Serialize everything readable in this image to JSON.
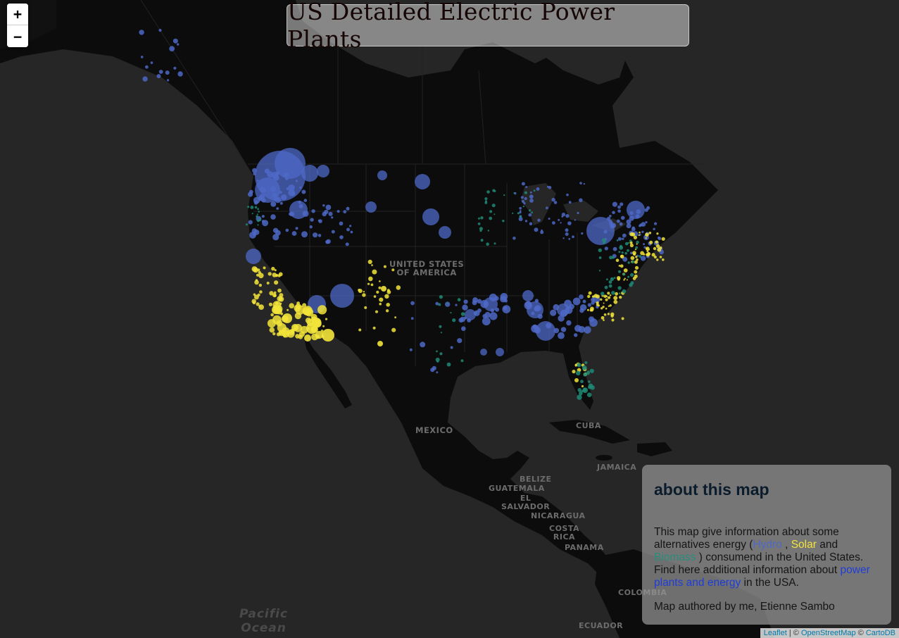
{
  "title": "US Detailed Electric Power Plants",
  "zoom": {
    "in_label": "+",
    "out_label": "−"
  },
  "map_labels": {
    "usa_line1": "UNITED STATES",
    "usa_line2": "OF AMERICA",
    "mexico": "MEXICO",
    "cuba": "CUBA",
    "jamaica": "JAMAICA",
    "belize": "BELIZE",
    "guatemala": "GUATEMALA",
    "el_salvador_line1": "EL",
    "el_salvador_line2": "SALVADOR",
    "nicaragua": "NICARAGUA",
    "costa_rica_line1": "COSTA",
    "costa_rica_line2": "RICA",
    "panama": "PANAMA",
    "colombia": "COLOMBIA",
    "ecuador": "ECUADOR",
    "pacific_line1": "Pacific",
    "pacific_line2": "Ocean"
  },
  "about": {
    "heading": "about this map",
    "p1_before": "This map give information about some alternatives energy (",
    "hydro": "Hydro",
    "sep1": " , ",
    "solar": "Solar",
    "sep2": " and ",
    "biomass": "Biomass",
    "p1_after": " ) consumend in the United States. Find here additional information about ",
    "link": "power plants and energy",
    "p1_end": " in the USA.",
    "p2": "Map authored by me, Etienne Sambo"
  },
  "attribution": {
    "leaflet": "Leaflet",
    "sep1": " | © ",
    "osm": "OpenStreetMap",
    "sep2": " © ",
    "cartodb": "CartoDB"
  },
  "colors": {
    "hydro": "#4d68c7",
    "solar": "#f2e43a",
    "biomass": "#1f8a76",
    "land": "#0c0c0c",
    "water": "#262626"
  },
  "legend": [
    "Hydro",
    "Solar",
    "Biomass"
  ]
}
